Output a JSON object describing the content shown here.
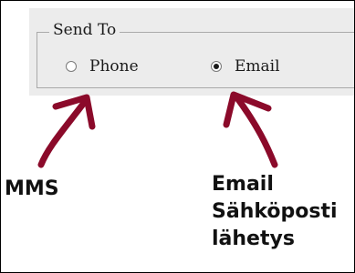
{
  "send_to": {
    "legend": "Send To",
    "options": [
      {
        "label": "Phone",
        "checked": false
      },
      {
        "label": "Email",
        "checked": true
      }
    ]
  },
  "annotations": {
    "mms": [
      "MMS"
    ],
    "email": [
      "Email",
      "Sähköposti",
      "lähetys"
    ],
    "arrow_color": "#8b0a2a"
  },
  "colors": {
    "dialog_background": "#ececec",
    "group_border": "#a9a9a9"
  }
}
